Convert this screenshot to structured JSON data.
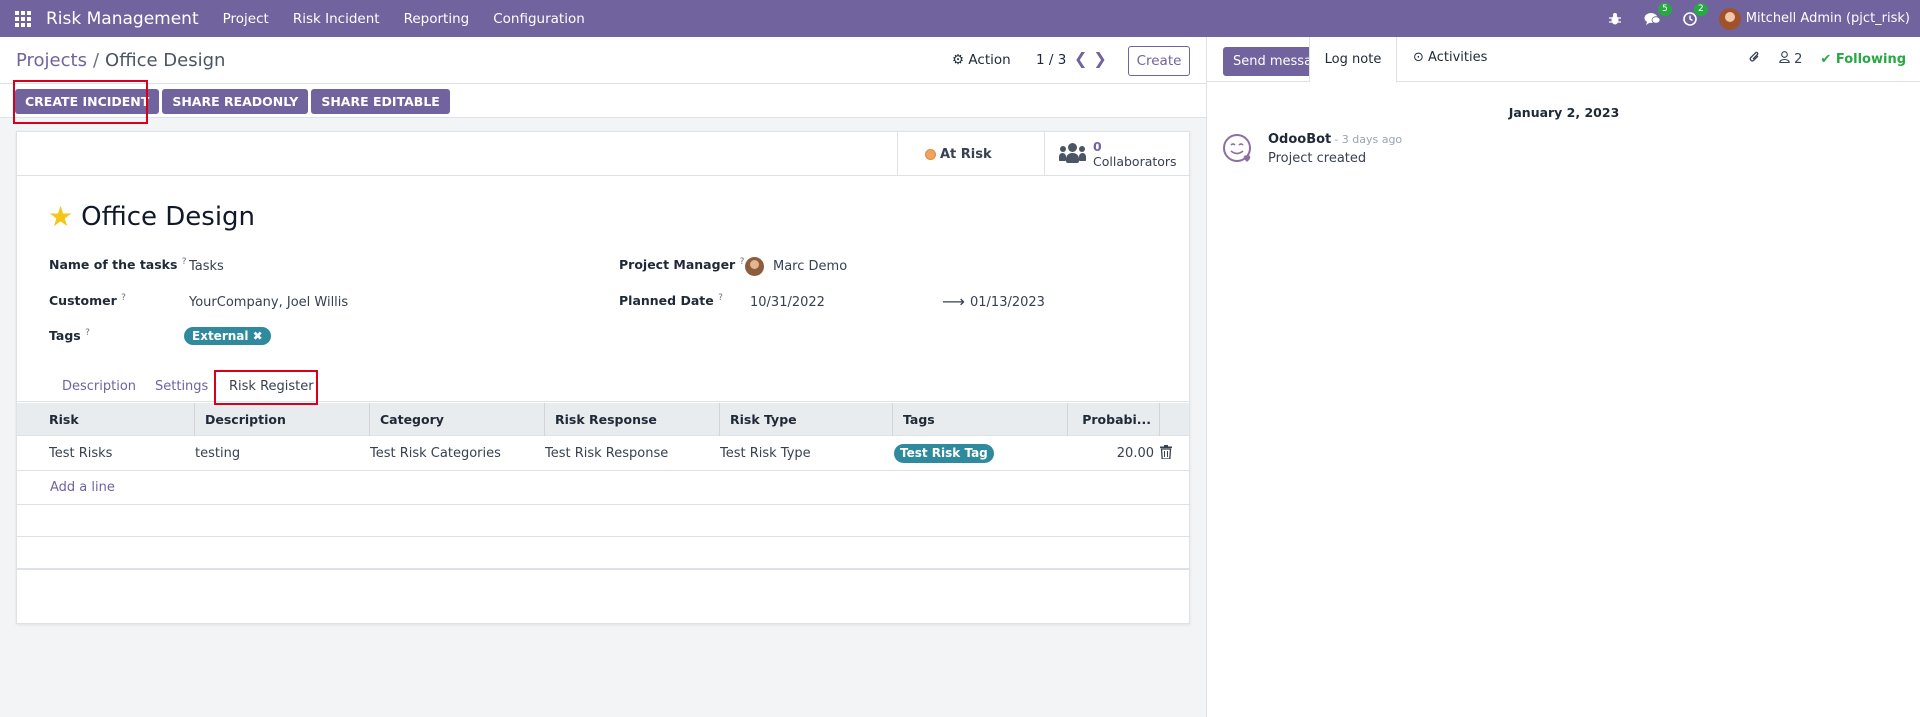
{
  "navbar": {
    "brand": "Risk Management",
    "menu": [
      "Project",
      "Risk Incident",
      "Reporting",
      "Configuration"
    ],
    "messages_badge": "5",
    "activities_badge": "2",
    "user": "Mitchell Admin (pjct_risk)"
  },
  "control": {
    "breadcrumb_parent": "Projects",
    "breadcrumb_sep": "/",
    "breadcrumb_current": "Office Design",
    "action_label": "Action",
    "pager": "1 / 3",
    "create_label": "Create",
    "buttons": [
      "CREATE INCIDENT",
      "SHARE READONLY",
      "SHARE EDITABLE"
    ]
  },
  "stats": {
    "status": "At Risk",
    "collaborators_count": "0",
    "collaborators_label": "Collaborators"
  },
  "form": {
    "title": "Office Design",
    "name_tasks_label": "Name of the tasks",
    "name_tasks_value": "Tasks",
    "customer_label": "Customer",
    "customer_value": "YourCompany, Joel Willis",
    "tags_label": "Tags",
    "tag_value": "External",
    "pm_label": "Project Manager",
    "pm_value": "Marc Demo",
    "planned_label": "Planned Date",
    "planned_start": "10/31/2022",
    "planned_end": "01/13/2023",
    "help_mark": "?"
  },
  "tabs": [
    "Description",
    "Settings",
    "Risk Register"
  ],
  "table": {
    "columns": [
      "Risk",
      "Description",
      "Category",
      "Risk Response",
      "Risk Type",
      "Tags",
      "Probabi..."
    ],
    "row": {
      "risk": "Test Risks",
      "description": "testing",
      "category": "Test Risk Categories",
      "response": "Test Risk Response",
      "type": "Test Risk Type",
      "tag": "Test Risk Tag",
      "probability": "20.00"
    },
    "add_line": "Add a line"
  },
  "chatter": {
    "send_message": "Send message",
    "log_note": "Log note",
    "activities": "Activities",
    "followers_count": "2",
    "following": "Following",
    "date": "January 2, 2023",
    "author": "OdooBot",
    "time": "- 3 days ago",
    "body": "Project created"
  },
  "colors": {
    "brand": "#71639e",
    "tag": "#2f8a9e",
    "highlight": "#d9001b",
    "following": "#28a745",
    "at_risk": "#f0a35c"
  }
}
